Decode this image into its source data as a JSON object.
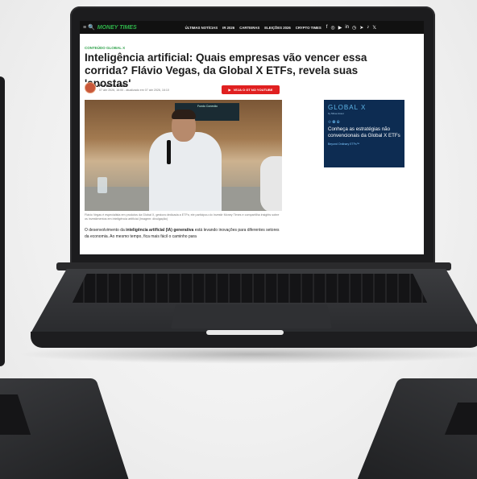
{
  "site": {
    "logo_left": "MONEY",
    "logo_right": "TIMES",
    "nav_links": [
      "ÚLTIMAS NOTÍCIAS",
      "IR 2026",
      "CARTEIRAS",
      "ELEIÇÕES 2026",
      "CRYPTO TIMES"
    ],
    "social_icons": [
      "f",
      "◎",
      "▶",
      "in",
      "◷",
      "➤",
      "♪",
      "𝕏"
    ]
  },
  "article": {
    "kicker": "CONTEÚDO GLOBAL X",
    "headline": "Inteligência artificial: Quais empresas vão vencer essa corrida? Flávio Vegas, da Global X ETFs, revela suas 'apostas'",
    "author": "Por Boris Bellini",
    "date": "07 abr 2026, 16:00 - atualizado em 07 abr 2026, 16:10",
    "youtube_button": "VEJA O GT NO YOUTUBE",
    "photo_tv_text": "Fundo Conexão",
    "caption": "Flávio Vegas é especialista em produtos da Global X, gestora dedicada a ETFs; ele participou do Investir Money Times e compartilha insights sobre os investimentos em inteligência artificial (Imagem: divulgação)",
    "body_intro": "O desenvolvimento da ",
    "body_bold": "inteligência artificial (IA) generativa",
    "body_rest": " está levando inovações para diferentes setores da economia. Ao mesmo tempo, fica mais fácil o caminho para"
  },
  "ad": {
    "logo": "GLOBAL X",
    "logo_sub": "by Mirae Asset",
    "icons": "⟐ ◍ ⊕",
    "title": "Conheça as estratégias não convencionais da Global X ETFs",
    "sub": "Beyond Ordinary ETFs™"
  }
}
